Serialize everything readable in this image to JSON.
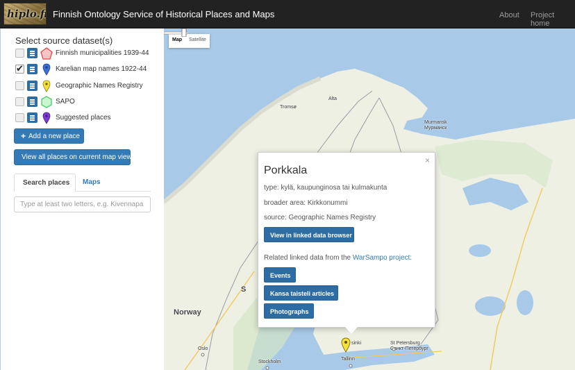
{
  "navbar": {
    "logo_text": "hiplo.fi",
    "title": "Finnish Ontology Service of Historical Places and Maps",
    "links": [
      "About",
      "Project home"
    ]
  },
  "sidebar": {
    "title": "Select source dataset(s)",
    "datasets": [
      {
        "label": "Finnish municipalities 1939-44",
        "checked": false,
        "icon": "red-polygon-icon"
      },
      {
        "label": "Karelian map names 1922-44",
        "checked": true,
        "icon": "blue-marker-icon"
      },
      {
        "label": "Geographic Names Registry",
        "checked": false,
        "icon": "yellow-marker-icon"
      },
      {
        "label": "SAPO",
        "checked": false,
        "icon": "green-polygon-icon"
      },
      {
        "label": "Suggested places",
        "checked": false,
        "icon": "purple-marker-icon"
      }
    ],
    "add_button": "Add a new place",
    "view_all_button": "View all places on current map view",
    "tabs": [
      "Search places",
      "Maps"
    ],
    "search_placeholder": "Type at least two letters, e.g. Kivennapa"
  },
  "map": {
    "map_types": [
      "Map",
      "Satellite"
    ],
    "labels": {
      "tromso": "Tromsø",
      "alta": "Alta",
      "murmansk": "Murmansk\nМурманск",
      "norway": "Norway",
      "oslo": "Oslo",
      "stockholm": "Stockholm",
      "tallinn": "Tallinn",
      "st_petersburg": "St Petersburg\nСанкт-Петербург",
      "helsinki_partial": "sinki",
      "s_partial": "S"
    }
  },
  "popup": {
    "close": "×",
    "title": "Porkkala",
    "type": "type: kylä, kaupunginosa tai kulmakunta",
    "broader": "broader area: Kirkkonummi",
    "source": "source: Geographic Names Registry",
    "linked_data_button": "View in linked data browser",
    "related_prefix": "Related linked data from the ",
    "related_link": "WarSampo project:",
    "buttons": [
      "Events",
      "Kansa taisteli articles",
      "Photographs"
    ]
  },
  "colors": {
    "navbar": "#222222",
    "primary": "#337ab7",
    "water": "#a8c9e8",
    "land": "#eef0e4"
  }
}
